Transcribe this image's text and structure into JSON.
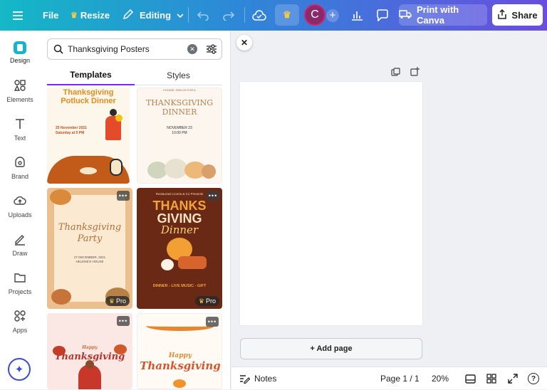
{
  "topbar": {
    "file_label": "File",
    "resize_label": "Resize",
    "editing_label": "Editing",
    "avatar_initial": "C",
    "print_label": "Print with Canva",
    "share_label": "Share"
  },
  "rail": {
    "items": [
      {
        "label": "Design"
      },
      {
        "label": "Elements"
      },
      {
        "label": "Text"
      },
      {
        "label": "Brand"
      },
      {
        "label": "Uploads"
      },
      {
        "label": "Draw"
      },
      {
        "label": "Projects"
      },
      {
        "label": "Apps"
      }
    ]
  },
  "panel": {
    "search_value": "Thanksgiving Posters",
    "tabs": [
      {
        "label": "Templates"
      },
      {
        "label": "Styles"
      }
    ],
    "templates": [
      {
        "lines": [
          "Thanksgiving",
          "Potluck Dinner",
          "25 November 2021",
          "Saturday at 5 PM"
        ]
      },
      {
        "lines": [
          "PLEASE JOIN US FOR A",
          "THANKSGIVING",
          "DINNER",
          "NOVEMBER 23",
          "10:00 PM"
        ]
      },
      {
        "lines": [
          "Thanksgiving",
          "Party",
          "27 DECEMBER, 2021",
          "HELENE'S HOUSE"
        ],
        "pro": "Pro"
      },
      {
        "lines": [
          "Restaurant Liceria & Co Presents",
          "THANKS",
          "GIVING",
          "Dinner",
          "DINNER - LIVE MUSIC - GIFT"
        ],
        "pro": "Pro"
      },
      {
        "lines": [
          "Happy",
          "Thanksgiving"
        ]
      },
      {
        "lines": [
          "Happy",
          "Thanksgiving"
        ]
      }
    ]
  },
  "editor": {
    "add_page_label": "+ Add page",
    "notes_label": "Notes",
    "page_indicator": "Page 1 / 1",
    "zoom": "20%"
  }
}
